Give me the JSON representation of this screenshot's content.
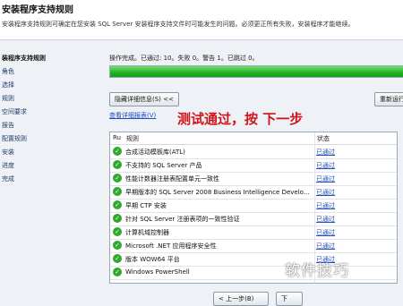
{
  "header": {
    "title": "安装程序支持规则",
    "description": "安装程序支持规则可确定在您安装 SQL Server 安装程序支持文件时可能发生的问题。必须更正所有失败，安装程序才能继续。"
  },
  "sidebar": {
    "items": [
      {
        "label": "装程序支持规则",
        "active": true
      },
      {
        "label": "角色",
        "active": false
      },
      {
        "label": "选择",
        "active": false
      },
      {
        "label": "规则",
        "active": false
      },
      {
        "label": "空间要求",
        "active": false
      },
      {
        "label": "报告",
        "active": false
      },
      {
        "label": "配置规则",
        "active": false
      },
      {
        "label": "安装",
        "active": false
      },
      {
        "label": "进度",
        "active": false
      },
      {
        "label": "完成",
        "active": false
      }
    ]
  },
  "status": {
    "text": "操作完成。已通过: 10。失败 0。警告 1。已跳过 0。"
  },
  "progress": {
    "value": 1.0,
    "color": "#23b223"
  },
  "buttons": {
    "hide_details": "隐藏详细信息(S) <<",
    "rerun": "重新运行",
    "back": "< 上一步(B)",
    "next": "下"
  },
  "links": {
    "view_report": "查看详细报表(V)"
  },
  "overlay_text": "测试通过，按 下一步",
  "table": {
    "headers": {
      "num": "Ru",
      "rule": "规则",
      "status": "状态"
    },
    "rows": [
      {
        "rule": "合成活动模板库(ATL)",
        "status": "已通过"
      },
      {
        "rule": "不支持的 SQL Server 产品",
        "status": "已通过"
      },
      {
        "rule": "性能计数器注册表配置单元一致性",
        "status": "已通过"
      },
      {
        "rule": "早期版本的 SQL Server 2008 Business Intelligence Develo...",
        "status": "已通过"
      },
      {
        "rule": "早期 CTP 安装",
        "status": "已通过"
      },
      {
        "rule": "针对 SQL Server 注册表项的一致性验证",
        "status": "已通过"
      },
      {
        "rule": "计算机域控制器",
        "status": "已通过"
      },
      {
        "rule": "Microsoft .NET 应用程序安全性",
        "status": "已通过"
      },
      {
        "rule": "版本 WOW64 平台",
        "status": "已通过"
      },
      {
        "rule": "Windows PowerShell",
        "status": ""
      }
    ]
  },
  "watermark": "软件技巧"
}
